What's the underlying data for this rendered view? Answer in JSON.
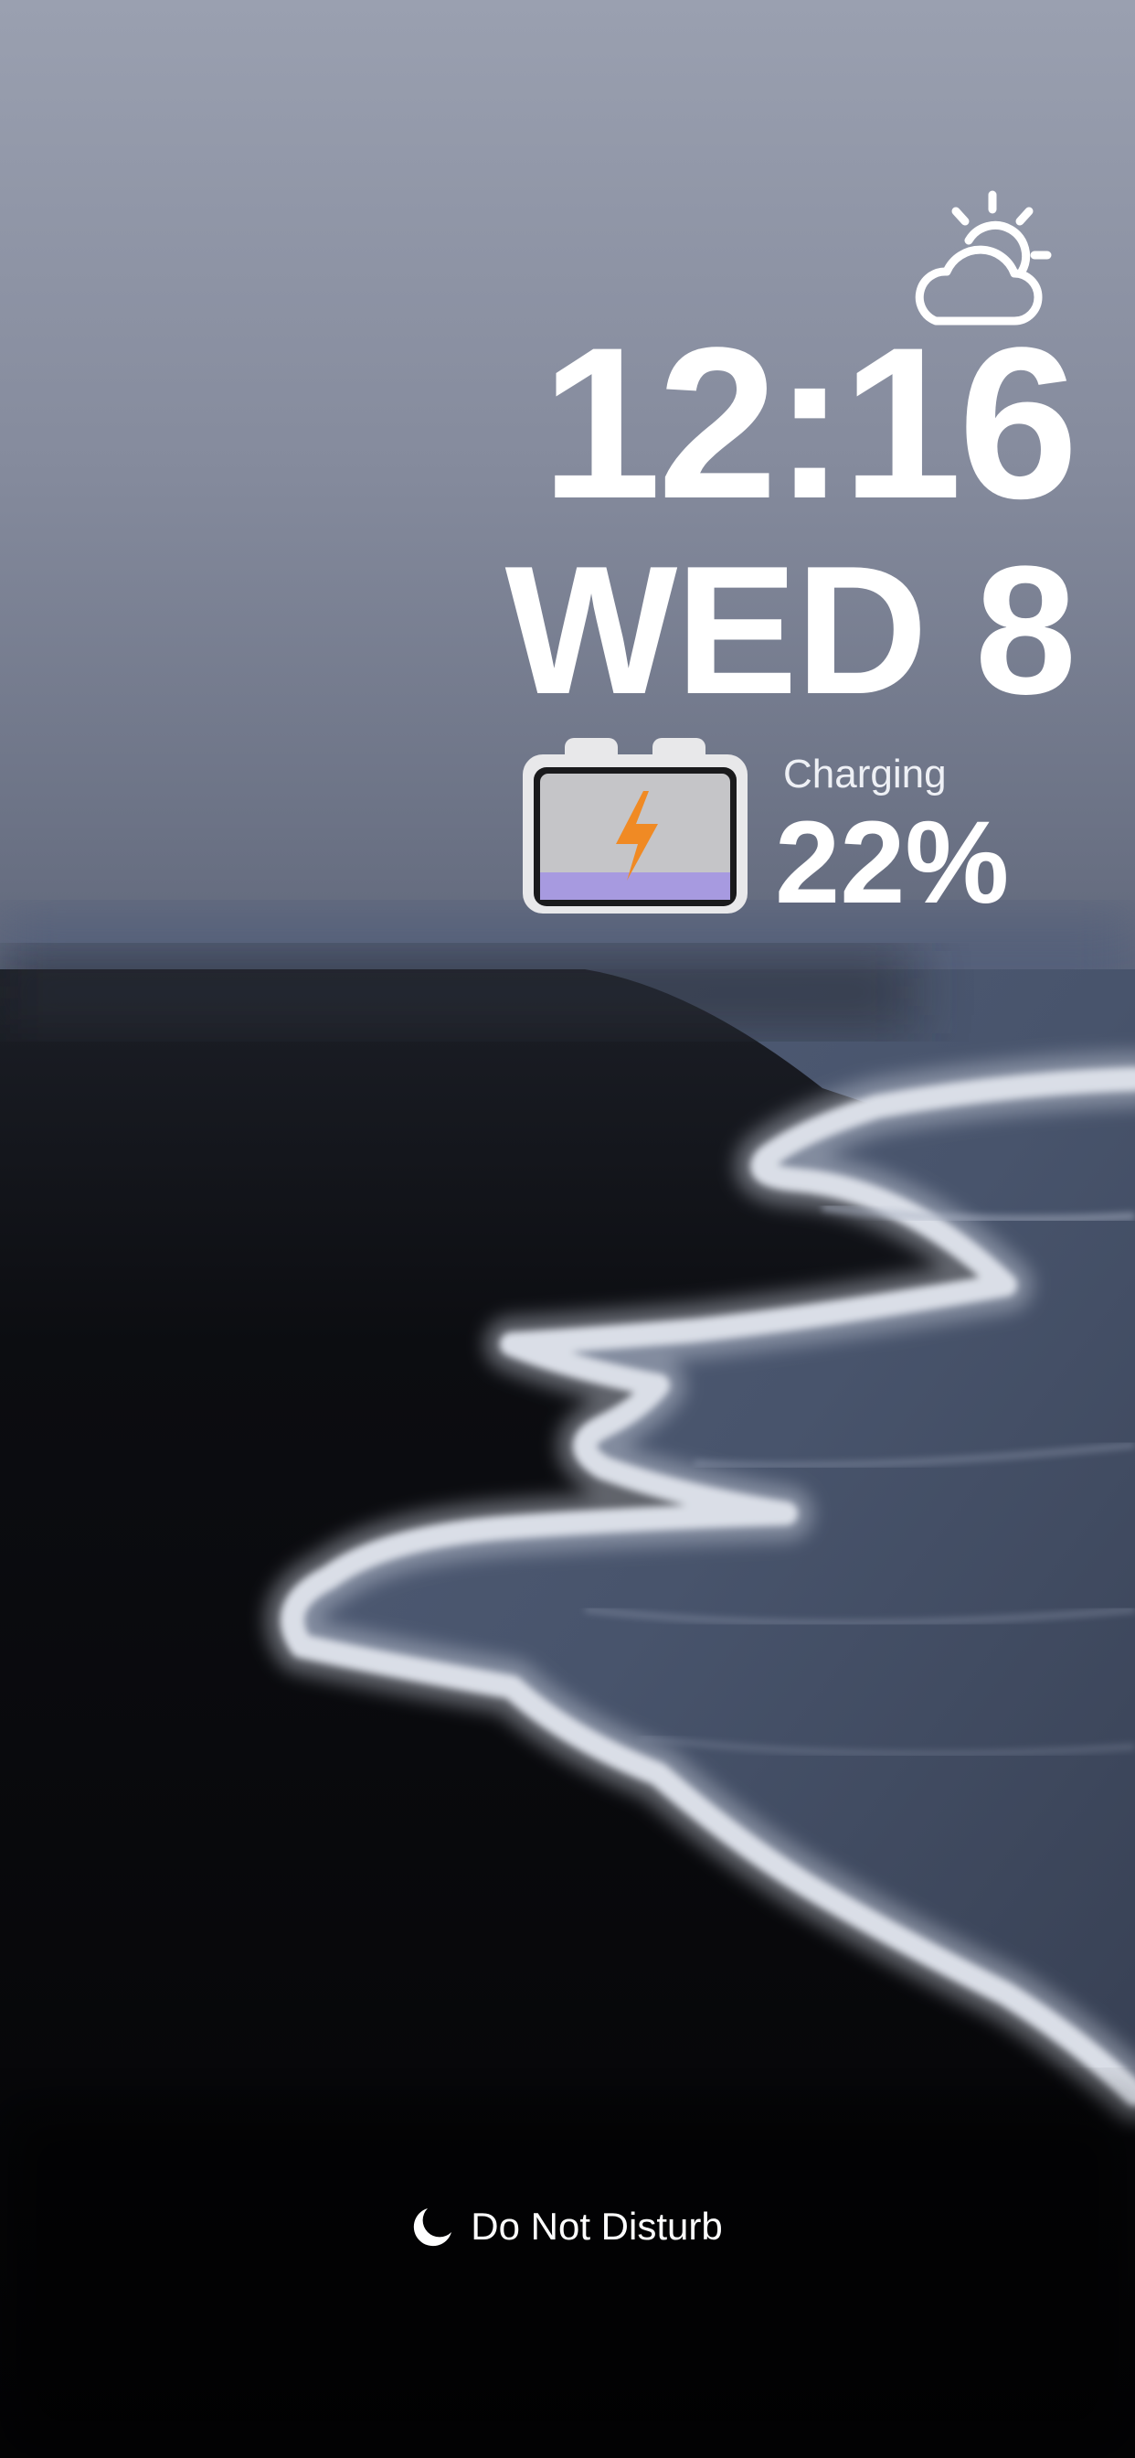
{
  "lock_screen": {
    "time": "12:16",
    "date": "WED 8",
    "weather": {
      "icon": "partly-sunny-icon"
    },
    "battery": {
      "status_label": "Charging",
      "percent_label": "22%",
      "level": 0.22,
      "icon": "battery-charging-icon",
      "fill_color": "#a79ae0",
      "bolt_color": "#f08a24"
    },
    "focus": {
      "icon": "moon-icon",
      "label": "Do Not Disturb"
    }
  }
}
